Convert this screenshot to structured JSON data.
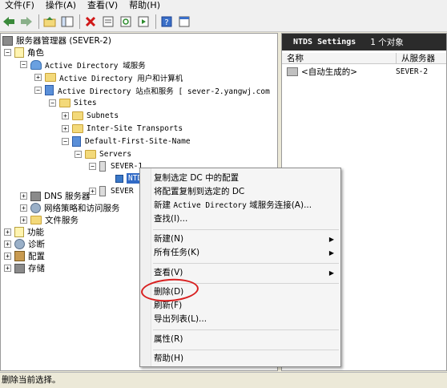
{
  "menubar": [
    "文件(F)",
    "操作(A)",
    "查看(V)",
    "帮助(H)"
  ],
  "toolbar": {
    "icons": [
      "back-icon",
      "forward-icon",
      "up-icon",
      "show-tree-icon",
      "delete-icon",
      "properties-icon",
      "refresh-icon",
      "export-icon",
      "help-icon",
      "console-icon"
    ]
  },
  "tree": {
    "root": "服务器管理器 (SEVER-2)",
    "roles": "角色",
    "ad_ds": "Active Directory 域服务",
    "ad_users": "Active Directory 用户和计算机",
    "ad_sites": "Active Directory 站点和服务 [ sever-2.yangwj.com",
    "sites": "Sites",
    "subnets": "Subnets",
    "inter_site": "Inter-Site Transports",
    "default_site": "Default-First-Site-Name",
    "servers": "Servers",
    "sever1": "SEVER-1",
    "ntds": "NTDS",
    "sever2": "SEVER",
    "dns": "DNS 服务器",
    "nps": "网络策略和访问服务",
    "file": "文件服务",
    "features": "功能",
    "diagnostics": "诊断",
    "config": "配置",
    "storage": "存储"
  },
  "list": {
    "title": "NTDS Settings",
    "count": "1 个对象",
    "col_name": "名称",
    "col_from": "从服务器",
    "rows": [
      {
        "name": "<自动生成的>",
        "from": "SEVER-2"
      }
    ]
  },
  "context_menu": {
    "replicate_from": "复制选定 DC 中的配置",
    "replicate_to": "将配置复制到选定的 DC",
    "new_connection_cn": "新建",
    "new_connection_en": "Active Directory",
    "new_connection_tail": "域服务连接(A)...",
    "find": "查找(I)...",
    "new": "新建(N)",
    "all_tasks": "所有任务(K)",
    "view": "查看(V)",
    "delete": "删除(D)",
    "refresh": "刷新(F)",
    "export": "导出列表(L)...",
    "properties": "属性(R)",
    "help": "帮助(H)"
  },
  "status": "删除当前选择。"
}
